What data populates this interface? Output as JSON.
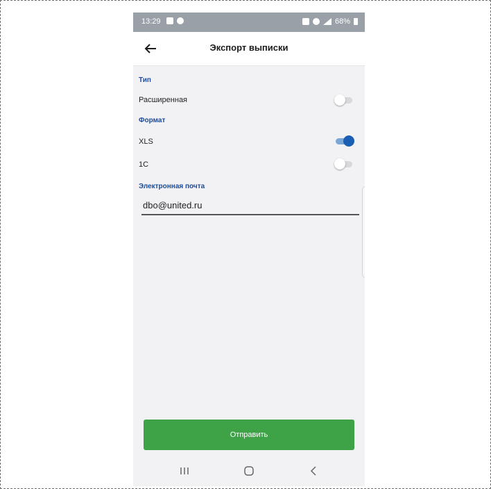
{
  "status_bar": {
    "time": "13:29",
    "battery": "68%",
    "icons": [
      "gallery-icon",
      "settings-icon",
      "alarm-icon",
      "bluetooth-icon",
      "signal-icon",
      "battery-icon"
    ]
  },
  "header": {
    "title": "Экспорт выписки"
  },
  "form": {
    "type_section_label": "Тип",
    "extended_label": "Расширенная",
    "extended_enabled": false,
    "format_section_label": "Формат",
    "xls_label": "XLS",
    "xls_enabled": true,
    "onec_label": "1С",
    "onec_enabled": false,
    "email_section_label": "Электронная почта",
    "email_value": "dbo@united.ru"
  },
  "actions": {
    "send_label": "Отправить"
  },
  "colors": {
    "accent_blue": "#1a5fb4",
    "section_label": "#1a4c9c",
    "send_button": "#3ea346",
    "status_bar": "#9aa0a8"
  }
}
